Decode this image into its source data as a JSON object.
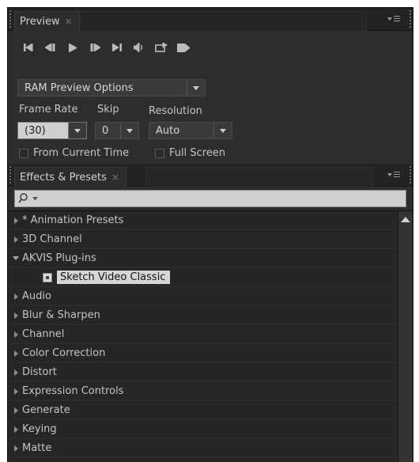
{
  "preview": {
    "tab_label": "Preview",
    "tab_close": "×",
    "transport": [
      "first-frame-icon",
      "prev-frame-icon",
      "play-icon",
      "next-frame-icon",
      "last-frame-icon",
      "audio-icon",
      "loop-icon",
      "ram-preview-icon"
    ],
    "options_select": "RAM Preview Options",
    "frame_rate_label": "Frame Rate",
    "skip_label": "Skip",
    "resolution_label": "Resolution",
    "frame_rate_value": "(30)",
    "skip_value": "0",
    "resolution_value": "Auto",
    "from_current_time_label": "From Current Time",
    "full_screen_label": "Full Screen"
  },
  "effects": {
    "tab_label": "Effects & Presets",
    "tab_close": "×",
    "search_placeholder": "",
    "items": [
      {
        "label": "* Animation Presets",
        "state": "collapsed"
      },
      {
        "label": "3D Channel",
        "state": "collapsed"
      },
      {
        "label": "AKVIS Plug-ins",
        "state": "expanded"
      },
      {
        "label": "Sketch Video Classic",
        "state": "child-selected"
      },
      {
        "label": "Audio",
        "state": "collapsed"
      },
      {
        "label": "Blur & Sharpen",
        "state": "collapsed"
      },
      {
        "label": "Channel",
        "state": "collapsed"
      },
      {
        "label": "Color Correction",
        "state": "collapsed"
      },
      {
        "label": "Distort",
        "state": "collapsed"
      },
      {
        "label": "Expression Controls",
        "state": "collapsed"
      },
      {
        "label": "Generate",
        "state": "collapsed"
      },
      {
        "label": "Keying",
        "state": "collapsed"
      },
      {
        "label": "Matte",
        "state": "collapsed"
      }
    ]
  }
}
